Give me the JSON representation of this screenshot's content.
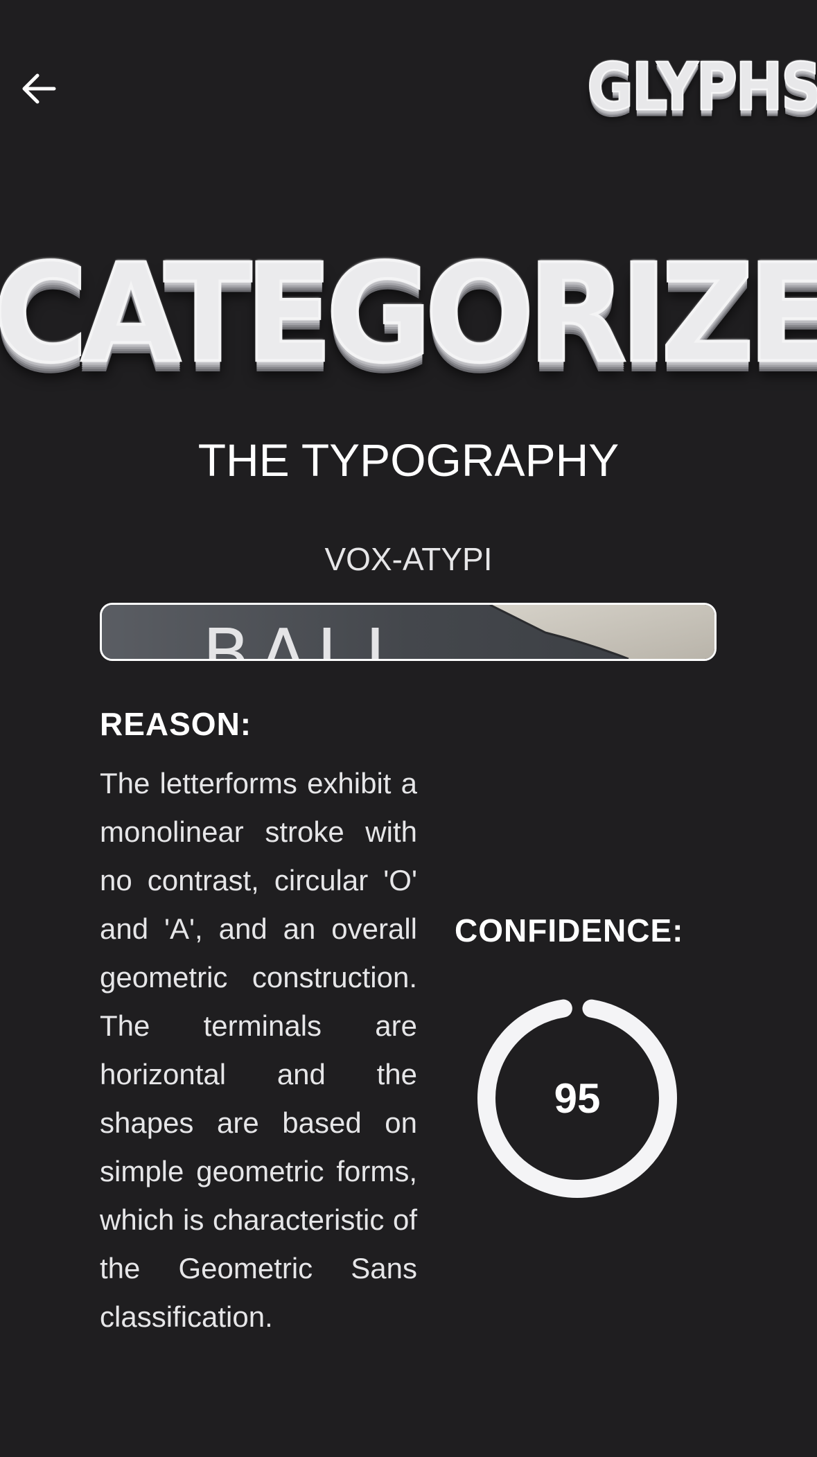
{
  "header": {
    "back_icon": "arrow-left-icon",
    "logo_text": "GLYPHS"
  },
  "hero": {
    "title": "CATEGORIZE",
    "subtitle": "THE TYPOGRAPHY"
  },
  "result": {
    "font_name": "VOX-ATYPI",
    "image_text": "BALL",
    "reason_label": "REASON:",
    "reason_text": "The letterforms exhibit a monolinear stroke with no contrast, circular 'O' and 'A', and an overall geometric construction. The terminals are horizontal and the shapes are based on simple geometric forms, which is characteristic of the Geometric Sans classification.",
    "confidence_label": "CONFIDENCE:",
    "confidence_value": "95",
    "confidence_fraction": 0.95
  },
  "colors": {
    "background": "#1f1e20",
    "text": "#ffffff",
    "gauge_ring": "#f4f4f6"
  }
}
